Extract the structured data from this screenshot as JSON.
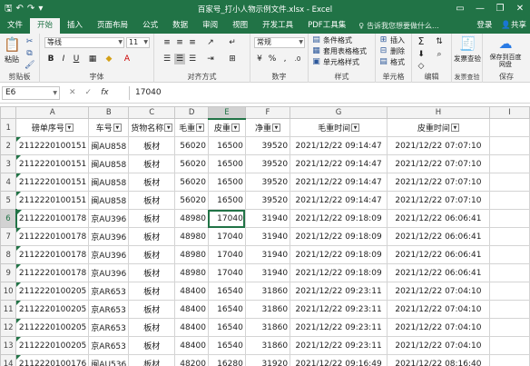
{
  "titlebar": {
    "save_icon": "save-icon",
    "undo_icon": "undo-icon",
    "redo_icon": "redo-icon",
    "title": "百家号_打小人物示例文件.xlsx - Excel",
    "minimize": "—",
    "restore": "❐",
    "close": "✕"
  },
  "tabs": [
    "文件",
    "开始",
    "插入",
    "页面布局",
    "公式",
    "数据",
    "审阅",
    "视图",
    "开发工具",
    "PDF工具集"
  ],
  "active_tab": "开始",
  "tell_me": "告诉我您想要做什么...",
  "login": "登录",
  "share": "共享",
  "ribbon": {
    "paste": "粘贴",
    "clipboard": "剪贴板",
    "font_name": "等线",
    "font_size": "11",
    "grow_font": "A",
    "shrink_font": "A",
    "bold": "B",
    "italic": "I",
    "underline": "U",
    "font_group": "字体",
    "wrap": "常规",
    "align_group": "对齐方式",
    "number_format": "常规",
    "percent": "%",
    "comma": ",",
    "number_group": "数字",
    "cond_format": "条件格式",
    "table_format": "套用表格格式",
    "cell_style": "单元格样式",
    "styles_group": "样式",
    "insert": "插入",
    "delete": "删除",
    "format": "格式",
    "cells_group": "单元格",
    "edit_group": "编辑",
    "invoice_check": "发票查验",
    "invoice_check_group": "发票查验",
    "save_to_baidu": "保存到百度网盘",
    "save_group": "保存"
  },
  "formula_bar": {
    "name_box": "E6",
    "cancel": "✕",
    "confirm": "✓",
    "fx": "fx",
    "value": "17040"
  },
  "sheet": {
    "col_letters": [
      "A",
      "B",
      "C",
      "D",
      "E",
      "F",
      "G",
      "H",
      "I"
    ],
    "active_col": "E",
    "active_row": 6,
    "headers": [
      "磅单序号",
      "车号",
      "货物名称",
      "毛重",
      "皮重",
      "净重",
      "毛重时间",
      "皮重时间"
    ],
    "rows": [
      [
        "2112220100151",
        "闽AU858",
        "板材",
        "56020",
        "16500",
        "39520",
        "2021/12/22 09:14:47",
        "2021/12/22 07:07:10"
      ],
      [
        "2112220100151",
        "闽AU858",
        "板材",
        "56020",
        "16500",
        "39520",
        "2021/12/22 09:14:47",
        "2021/12/22 07:07:10"
      ],
      [
        "2112220100151",
        "闽AU858",
        "板材",
        "56020",
        "16500",
        "39520",
        "2021/12/22 09:14:47",
        "2021/12/22 07:07:10"
      ],
      [
        "2112220100151",
        "闽AU858",
        "板材",
        "56020",
        "16500",
        "39520",
        "2021/12/22 09:14:47",
        "2021/12/22 07:07:10"
      ],
      [
        "2112220100178",
        "京AU396",
        "板材",
        "48980",
        "17040",
        "31940",
        "2021/12/22 09:18:09",
        "2021/12/22 06:06:41"
      ],
      [
        "2112220100178",
        "京AU396",
        "板材",
        "48980",
        "17040",
        "31940",
        "2021/12/22 09:18:09",
        "2021/12/22 06:06:41"
      ],
      [
        "2112220100178",
        "京AU396",
        "板材",
        "48980",
        "17040",
        "31940",
        "2021/12/22 09:18:09",
        "2021/12/22 06:06:41"
      ],
      [
        "2112220100178",
        "京AU396",
        "板材",
        "48980",
        "17040",
        "31940",
        "2021/12/22 09:18:09",
        "2021/12/22 06:06:41"
      ],
      [
        "2112220100205",
        "京AR653",
        "板材",
        "48400",
        "16540",
        "31860",
        "2021/12/22 09:23:11",
        "2021/12/22 07:04:10"
      ],
      [
        "2112220100205",
        "京AR653",
        "板材",
        "48400",
        "16540",
        "31860",
        "2021/12/22 09:23:11",
        "2021/12/22 07:04:10"
      ],
      [
        "2112220100205",
        "京AR653",
        "板材",
        "48400",
        "16540",
        "31860",
        "2021/12/22 09:23:11",
        "2021/12/22 07:04:10"
      ],
      [
        "2112220100205",
        "京AR653",
        "板材",
        "48400",
        "16540",
        "31860",
        "2021/12/22 09:23:11",
        "2021/12/22 07:04:10"
      ],
      [
        "2112220100176",
        "闽AU536",
        "板材",
        "48200",
        "16280",
        "31920",
        "2021/12/22 09:16:49",
        "2021/12/22 08:16:40"
      ]
    ]
  }
}
